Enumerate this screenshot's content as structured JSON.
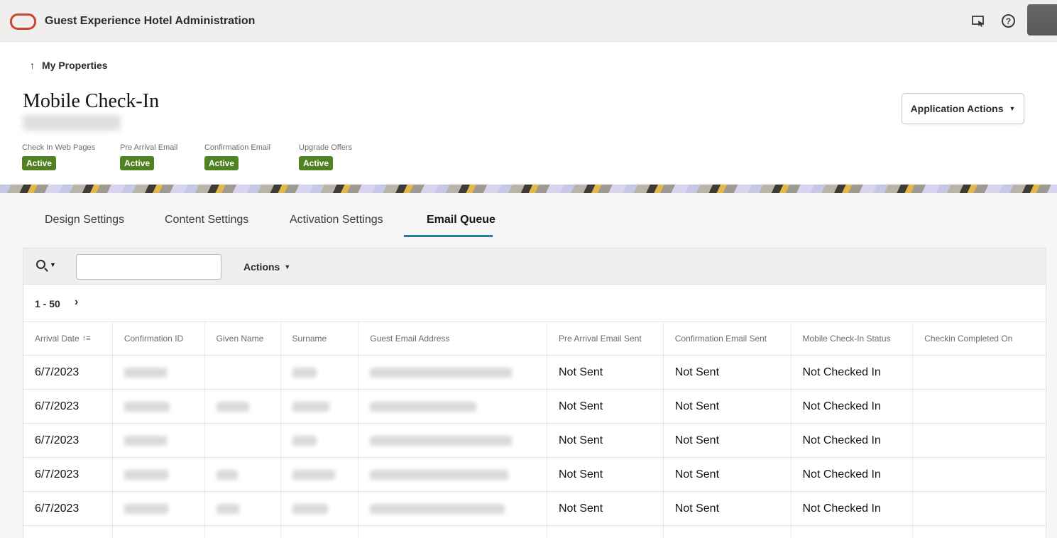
{
  "header": {
    "app_title": "Guest Experience Hotel Administration",
    "icons": [
      "remote-desktop-icon",
      "help-icon",
      "avatar"
    ],
    "help_glyph": "?"
  },
  "nav": {
    "back_label": "My Properties",
    "back_arrow": "↑"
  },
  "page": {
    "title": "Mobile Check-In",
    "application_actions_label": "Application Actions"
  },
  "statuses": [
    {
      "label": "Check In Web Pages",
      "value": "Active"
    },
    {
      "label": "Pre Arrival Email",
      "value": "Active"
    },
    {
      "label": "Confirmation Email",
      "value": "Active"
    },
    {
      "label": "Upgrade Offers",
      "value": "Active"
    }
  ],
  "tabs": [
    {
      "label": "Design Settings",
      "active": false
    },
    {
      "label": "Content Settings",
      "active": false
    },
    {
      "label": "Activation Settings",
      "active": false
    },
    {
      "label": "Email Queue",
      "active": true
    }
  ],
  "toolbar": {
    "search_value": "",
    "actions_label": "Actions"
  },
  "pager": {
    "range": "1 - 50",
    "next_glyph": "›"
  },
  "table": {
    "columns": [
      "Arrival Date",
      "Confirmation ID",
      "Given Name",
      "Surname",
      "Guest Email Address",
      "Pre Arrival Email Sent",
      "Confirmation Email Sent",
      "Mobile Check-In Status",
      "Checkin Completed On"
    ],
    "rows": [
      [
        "6/7/2023",
        "",
        "",
        "",
        "",
        "Not Sent",
        "Not Sent",
        "Not Checked In",
        ""
      ],
      [
        "6/7/2023",
        "",
        "",
        "",
        "",
        "Not Sent",
        "Not Sent",
        "Not Checked In",
        ""
      ],
      [
        "6/7/2023",
        "",
        "",
        "",
        "",
        "Not Sent",
        "Not Sent",
        "Not Checked In",
        ""
      ],
      [
        "6/7/2023",
        "",
        "",
        "",
        "",
        "Not Sent",
        "Not Sent",
        "Not Checked In",
        ""
      ],
      [
        "6/7/2023",
        "",
        "",
        "",
        "",
        "Not Sent",
        "Not Sent",
        "Not Checked In",
        ""
      ]
    ]
  },
  "colors": {
    "brand": "#c74634",
    "active_badge": "#508223",
    "tab_underline": "#227e9e"
  }
}
